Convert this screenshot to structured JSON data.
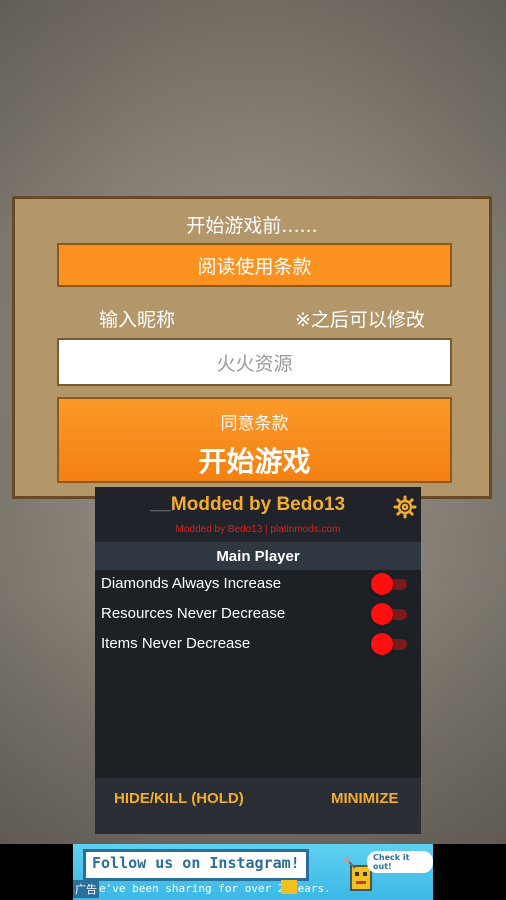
{
  "game": {
    "title": "开始游戏前......",
    "read_terms_button": "阅读使用条款",
    "nickname_label": "输入昵称",
    "nickname_note": "※之后可以修改",
    "nickname_value": "火火资源",
    "agree_label": "同意条款",
    "start_button": "开始游戏"
  },
  "mod_menu": {
    "title": "Modded by Bedo13",
    "subtitle": "Modded by Bedo13 | platinmods.com",
    "section": "Main Player",
    "options": [
      {
        "label": "Diamonds Always Increase",
        "enabled": true
      },
      {
        "label": "Resources Never Decrease",
        "enabled": true
      },
      {
        "label": "Items Never Decrease",
        "enabled": true
      }
    ],
    "hide_button": "HIDE/KILL (HOLD)",
    "minimize_button": "MINIMIZE",
    "accent_color": "#f4ad2a",
    "toggle_color": "#ff0f0f"
  },
  "ad": {
    "headline": "Follow us on Instagram!",
    "tag": "广告",
    "body": "e've been sharing for over 2 years.",
    "cta": "Check it out!"
  }
}
